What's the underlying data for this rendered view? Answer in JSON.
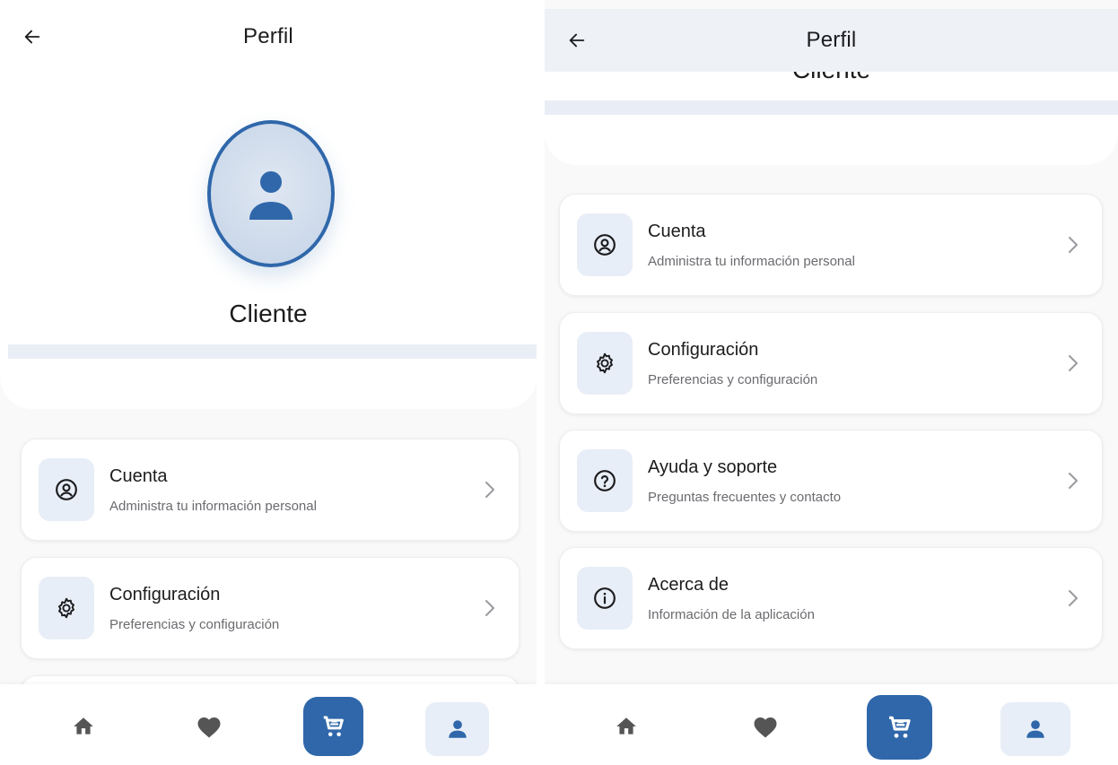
{
  "left": {
    "header": {
      "title": "Perfil"
    },
    "profile": {
      "name": "Cliente"
    },
    "menu": [
      {
        "title": "Cuenta",
        "subtitle": "Administra tu información personal",
        "icon": "account-circle-icon"
      },
      {
        "title": "Configuración",
        "subtitle": "Preferencias y configuración",
        "icon": "gear-icon"
      }
    ]
  },
  "right": {
    "header": {
      "title": "Perfil"
    },
    "profile": {
      "name": "Cliente"
    },
    "menu": [
      {
        "title": "Cuenta",
        "subtitle": "Administra tu información personal",
        "icon": "account-circle-icon"
      },
      {
        "title": "Configuración",
        "subtitle": "Preferencias y configuración",
        "icon": "gear-icon"
      },
      {
        "title": "Ayuda y soporte",
        "subtitle": "Preguntas frecuentes y contacto",
        "icon": "help-icon"
      },
      {
        "title": "Acerca de",
        "subtitle": "Información de la aplicación",
        "icon": "info-icon"
      }
    ]
  },
  "bottom_nav": {
    "items": [
      {
        "icon": "home-icon"
      },
      {
        "icon": "heart-icon"
      },
      {
        "icon": "cart-icon",
        "active_style": "filled"
      },
      {
        "icon": "person-icon",
        "active": true
      }
    ]
  },
  "colors": {
    "primary": "#2f67aa",
    "icon_bg": "#e8eef7",
    "text": "#1c1c1e",
    "subtext": "#6b6b70",
    "nav_icon": "#555555"
  }
}
